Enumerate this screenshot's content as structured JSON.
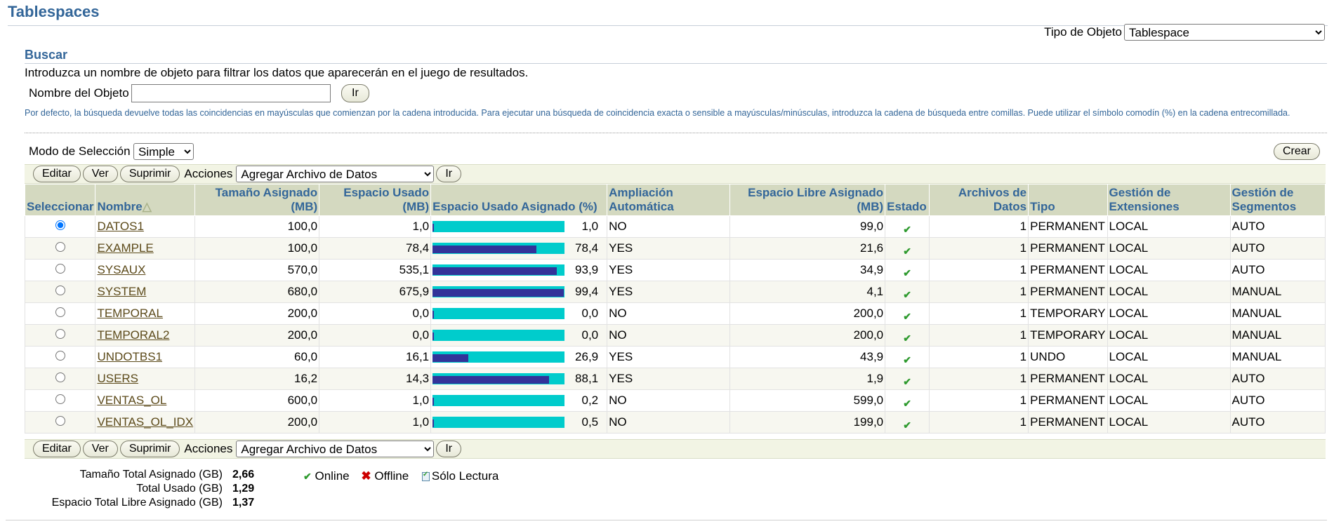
{
  "page": {
    "title": "Tablespaces"
  },
  "object_type": {
    "label": "Tipo de Objeto",
    "value": "Tablespace"
  },
  "search": {
    "title": "Buscar",
    "intro": "Introduzca un nombre de objeto para filtrar los datos que aparecerán en el juego de resultados.",
    "field_label": "Nombre del Objeto",
    "field_value": "",
    "go_label": "Ir",
    "hint": "Por defecto, la búsqueda devuelve todas las coincidencias en mayúsculas que comienzan por la cadena introducida. Para ejecutar una búsqueda de coincidencia exacta o sensible a mayúsculas/minúsculas, introduzca la cadena de búsqueda entre comillas. Puede utilizar el símbolo comodín (%) en la cadena entrecomillada."
  },
  "selection": {
    "label": "Modo de Selección",
    "value": "Simple"
  },
  "create_label": "Crear",
  "toolbar": {
    "edit": "Editar",
    "view": "Ver",
    "delete": "Suprimir",
    "actions_label": "Acciones",
    "actions_value": "Agregar Archivo de Datos",
    "go": "Ir"
  },
  "columns": {
    "select": "Seleccionar",
    "name": "Nombre",
    "size1": "Tamaño Asignado",
    "size2": "(MB)",
    "used1": "Espacio Usado",
    "used2": "(MB)",
    "pct": "Espacio Usado Asignado (%)",
    "auto1": "Ampliación",
    "auto2": "Automática",
    "free1": "Espacio Libre Asignado",
    "free2": "(MB)",
    "status": "Estado",
    "files1": "Archivos de",
    "files2": "Datos",
    "type": "Tipo",
    "ext1": "Gestión de",
    "ext2": "Extensiones",
    "seg1": "Gestión de",
    "seg2": "Segmentos"
  },
  "rows": [
    {
      "name": "DATOS1",
      "size": "100,0",
      "used": "1,0",
      "pct": "1,0",
      "pct_value": 1.0,
      "auto": "NO",
      "free": "99,0",
      "files": "1",
      "type": "PERMANENT",
      "ext": "LOCAL",
      "seg": "AUTO",
      "selected": true
    },
    {
      "name": "EXAMPLE",
      "size": "100,0",
      "used": "78,4",
      "pct": "78,4",
      "pct_value": 78.4,
      "auto": "YES",
      "free": "21,6",
      "files": "1",
      "type": "PERMANENT",
      "ext": "LOCAL",
      "seg": "AUTO",
      "selected": false
    },
    {
      "name": "SYSAUX",
      "size": "570,0",
      "used": "535,1",
      "pct": "93,9",
      "pct_value": 93.9,
      "auto": "YES",
      "free": "34,9",
      "files": "1",
      "type": "PERMANENT",
      "ext": "LOCAL",
      "seg": "AUTO",
      "selected": false
    },
    {
      "name": "SYSTEM",
      "size": "680,0",
      "used": "675,9",
      "pct": "99,4",
      "pct_value": 99.4,
      "auto": "YES",
      "free": "4,1",
      "files": "1",
      "type": "PERMANENT",
      "ext": "LOCAL",
      "seg": "MANUAL",
      "selected": false
    },
    {
      "name": "TEMPORAL",
      "size": "200,0",
      "used": "0,0",
      "pct": "0,0",
      "pct_value": 0.0,
      "auto": "NO",
      "free": "200,0",
      "files": "1",
      "type": "TEMPORARY",
      "ext": "LOCAL",
      "seg": "MANUAL",
      "selected": false
    },
    {
      "name": "TEMPORAL2",
      "size": "200,0",
      "used": "0,0",
      "pct": "0,0",
      "pct_value": 0.0,
      "auto": "NO",
      "free": "200,0",
      "files": "1",
      "type": "TEMPORARY",
      "ext": "LOCAL",
      "seg": "MANUAL",
      "selected": false
    },
    {
      "name": "UNDOTBS1",
      "size": "60,0",
      "used": "16,1",
      "pct": "26,9",
      "pct_value": 26.9,
      "auto": "YES",
      "free": "43,9",
      "files": "1",
      "type": "UNDO",
      "ext": "LOCAL",
      "seg": "MANUAL",
      "selected": false
    },
    {
      "name": "USERS",
      "size": "16,2",
      "used": "14,3",
      "pct": "88,1",
      "pct_value": 88.1,
      "auto": "YES",
      "free": "1,9",
      "files": "1",
      "type": "PERMANENT",
      "ext": "LOCAL",
      "seg": "AUTO",
      "selected": false
    },
    {
      "name": "VENTAS_OL",
      "size": "600,0",
      "used": "1,0",
      "pct": "0,2",
      "pct_value": 0.2,
      "auto": "NO",
      "free": "599,0",
      "files": "1",
      "type": "PERMANENT",
      "ext": "LOCAL",
      "seg": "AUTO",
      "selected": false
    },
    {
      "name": "VENTAS_OL_IDX",
      "size": "200,0",
      "used": "1,0",
      "pct": "0,5",
      "pct_value": 0.5,
      "auto": "NO",
      "free": "199,0",
      "files": "1",
      "type": "PERMANENT",
      "ext": "LOCAL",
      "seg": "AUTO",
      "selected": false
    }
  ],
  "totals": {
    "size_label": "Tamaño Total Asignado (GB)",
    "size_value": "2,66",
    "used_label": "Total Usado (GB)",
    "used_value": "1,29",
    "free_label": "Espacio Total Libre Asignado (GB)",
    "free_value": "1,37"
  },
  "legend": {
    "online": "Online",
    "offline": "Offline",
    "readonly": "Sólo Lectura"
  },
  "colors": {
    "heading": "#336699",
    "meter_bg": "#00cccc",
    "meter_fill": "#333399",
    "header_bg": "#d4d9c0",
    "link": "#5c4a1a",
    "online": "#2e9a2e",
    "offline": "#cc0000"
  },
  "icons": {
    "status": "check-icon",
    "sort": "sort-ascending-icon"
  }
}
